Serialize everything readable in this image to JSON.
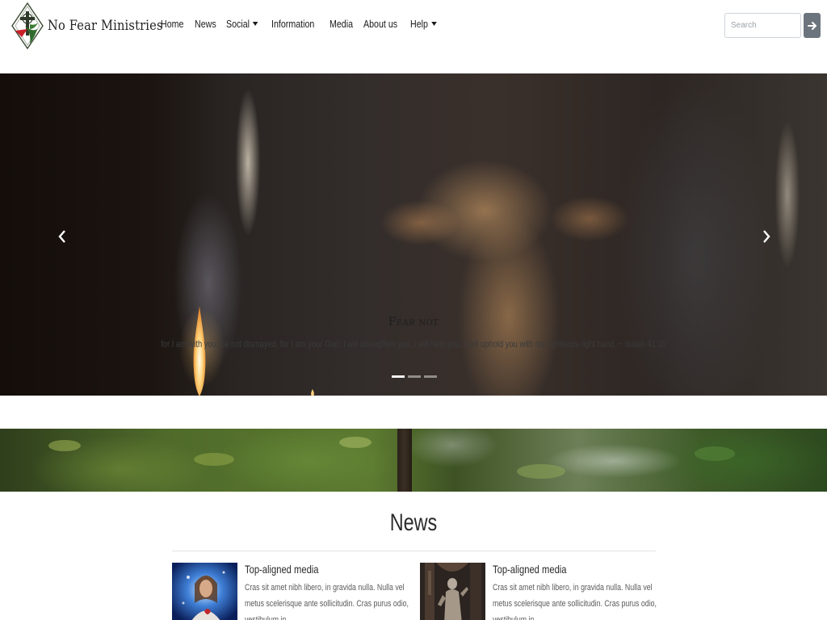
{
  "brand": {
    "name": "No Fear Ministries",
    "logo_icon": "cross-shield-logo"
  },
  "nav": {
    "items": [
      {
        "label": "Home",
        "dropdown": false
      },
      {
        "label": "News",
        "dropdown": false
      },
      {
        "label": "Social",
        "dropdown": true
      },
      {
        "label": "Information",
        "dropdown": false
      },
      {
        "label": "Media",
        "dropdown": false
      },
      {
        "label": "About us",
        "dropdown": false
      },
      {
        "label": "Help",
        "dropdown": true
      }
    ],
    "search": {
      "placeholder": "Search",
      "button_icon": "arrow-right-icon"
    }
  },
  "carousel": {
    "caption_title": "Fear not",
    "caption_text": "for I am with you; be not dismayed, for I am your God; I will strengthen you, I will help you, I will uphold you with my righteous right hand. ~ Isaiah 41:10",
    "slide_count": 3,
    "active_slide": 1,
    "prev_icon": "chevron-left-icon",
    "next_icon": "chevron-right-icon"
  },
  "news": {
    "heading": "News",
    "items": [
      {
        "title": "Top-aligned media",
        "text": "Cras sit amet nibh libero, in gravida nulla. Nulla vel metus scelerisque ante sollicitudin. Cras purus odio, vestibulum in",
        "thumb": "jesus-portrait-image"
      },
      {
        "title": "Top-aligned media",
        "text": "Cras sit amet nibh libero, in gravida nulla. Nulla vel metus scelerisque ante sollicitudin. Cras purus odio, vestibulum in",
        "thumb": "church-statue-image"
      }
    ]
  },
  "colors": {
    "search_button": "#6c757d",
    "text_dark": "#1a1a1a",
    "divider": "#e3e3e3"
  }
}
